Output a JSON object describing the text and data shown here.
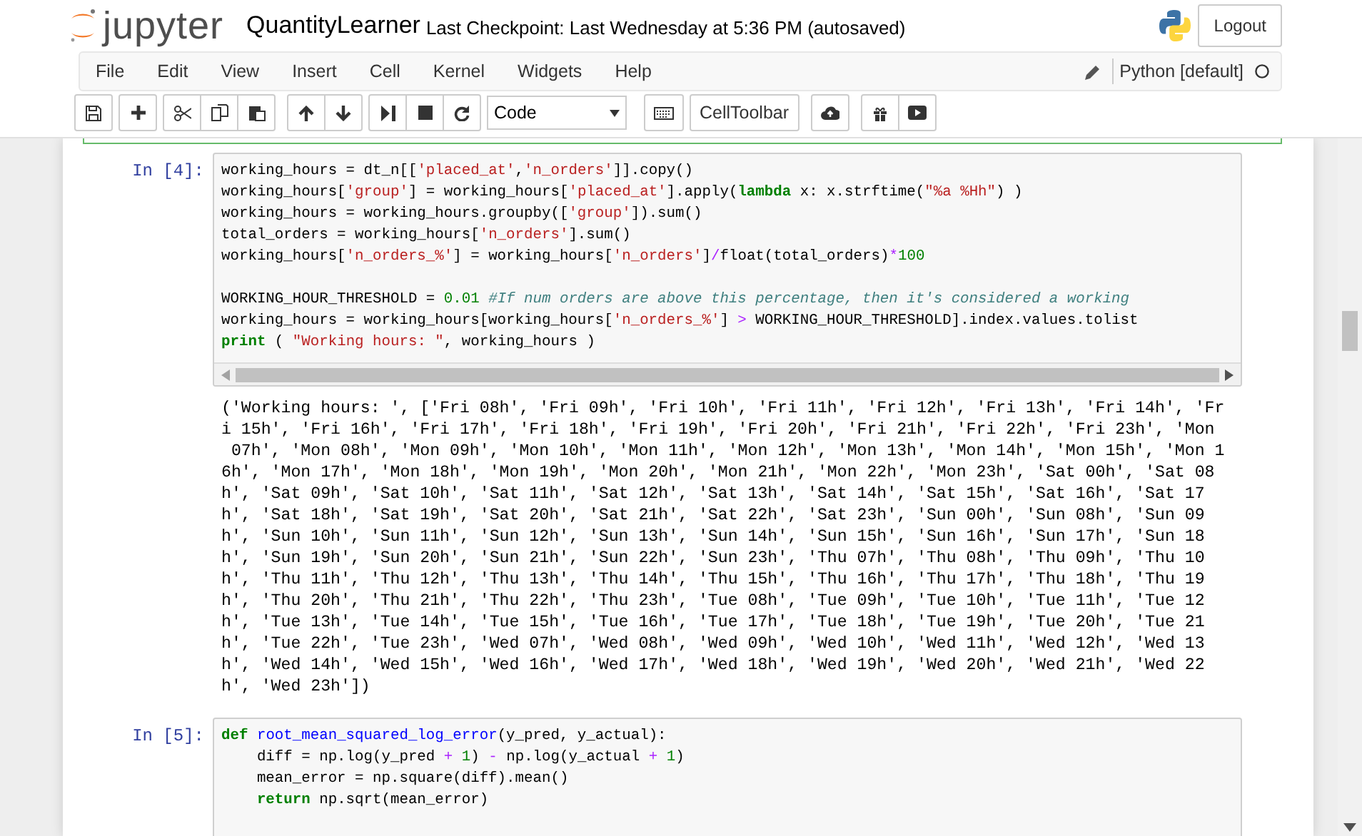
{
  "header": {
    "logo": "jupyter",
    "notebook_name": "QuantityLearner",
    "checkpoint": "Last Checkpoint: Last Wednesday at 5:36 PM (autosaved)",
    "logout": "Logout"
  },
  "menu": [
    "File",
    "Edit",
    "View",
    "Insert",
    "Cell",
    "Kernel",
    "Widgets",
    "Help"
  ],
  "kernel": {
    "name": "Python [default]",
    "busy": false
  },
  "toolbar": {
    "cell_type": "Code",
    "cell_toolbar": "CellToolbar"
  },
  "cells": [
    {
      "prompt": "In [4]:",
      "horizontal_scroll": true,
      "code": [
        {
          "tokens": [
            {
              "kind": "plain",
              "text": "working_hours = dt_n[["
            },
            {
              "kind": "str",
              "text": "'placed_at'"
            },
            {
              "kind": "plain",
              "text": ","
            },
            {
              "kind": "str",
              "text": "'n_orders'"
            },
            {
              "kind": "plain",
              "text": "]].copy()"
            }
          ]
        },
        {
          "tokens": [
            {
              "kind": "plain",
              "text": "working_hours["
            },
            {
              "kind": "str",
              "text": "'group'"
            },
            {
              "kind": "plain",
              "text": "] = working_hours["
            },
            {
              "kind": "str",
              "text": "'placed_at'"
            },
            {
              "kind": "plain",
              "text": "].apply("
            },
            {
              "kind": "kw",
              "text": "lambda"
            },
            {
              "kind": "plain",
              "text": " x: x.strftime("
            },
            {
              "kind": "str",
              "text": "\"%a %Hh\""
            },
            {
              "kind": "plain",
              "text": ") )"
            }
          ]
        },
        {
          "tokens": [
            {
              "kind": "plain",
              "text": "working_hours = working_hours.groupby(["
            },
            {
              "kind": "str",
              "text": "'group'"
            },
            {
              "kind": "plain",
              "text": "]).sum()"
            }
          ]
        },
        {
          "tokens": [
            {
              "kind": "plain",
              "text": "total_orders = working_hours["
            },
            {
              "kind": "str",
              "text": "'n_orders'"
            },
            {
              "kind": "plain",
              "text": "].sum()"
            }
          ]
        },
        {
          "tokens": [
            {
              "kind": "plain",
              "text": "working_hours["
            },
            {
              "kind": "str",
              "text": "'n_orders_%'"
            },
            {
              "kind": "plain",
              "text": "] = working_hours["
            },
            {
              "kind": "str",
              "text": "'n_orders'"
            },
            {
              "kind": "plain",
              "text": "]"
            },
            {
              "kind": "op",
              "text": "/"
            },
            {
              "kind": "plain",
              "text": "float(total_orders)"
            },
            {
              "kind": "op",
              "text": "*"
            },
            {
              "kind": "num",
              "text": "100"
            }
          ]
        },
        {
          "gap_before": true,
          "tokens": [
            {
              "kind": "plain",
              "text": "WORKING_HOUR_THRESHOLD = "
            },
            {
              "kind": "num",
              "text": "0.01"
            },
            {
              "kind": "comment",
              "text": " #If num orders are above this percentage, then it's considered a working"
            }
          ]
        },
        {
          "tokens": [
            {
              "kind": "plain",
              "text": "working_hours = working_hours[working_hours["
            },
            {
              "kind": "str",
              "text": "'n_orders_%'"
            },
            {
              "kind": "plain",
              "text": "] "
            },
            {
              "kind": "op",
              "text": ">"
            },
            {
              "kind": "plain",
              "text": " WORKING_HOUR_THRESHOLD].index.values.tolist"
            }
          ]
        },
        {
          "tokens": [
            {
              "kind": "kw",
              "text": "print"
            },
            {
              "kind": "plain",
              "text": " ( "
            },
            {
              "kind": "str",
              "text": "\"Working hours: \""
            },
            {
              "kind": "plain",
              "text": ", working_hours )"
            }
          ]
        }
      ],
      "output": [
        "('Working hours: ', ['Fri 08h', 'Fri 09h', 'Fri 10h', 'Fri 11h', 'Fri 12h', 'Fri 13h', 'Fri 14h', 'Fr",
        "i 15h', 'Fri 16h', 'Fri 17h', 'Fri 18h', 'Fri 19h', 'Fri 20h', 'Fri 21h', 'Fri 22h', 'Fri 23h', 'Mon",
        " 07h', 'Mon 08h', 'Mon 09h', 'Mon 10h', 'Mon 11h', 'Mon 12h', 'Mon 13h', 'Mon 14h', 'Mon 15h', 'Mon 1",
        "6h', 'Mon 17h', 'Mon 18h', 'Mon 19h', 'Mon 20h', 'Mon 21h', 'Mon 22h', 'Mon 23h', 'Sat 00h', 'Sat 08",
        "h', 'Sat 09h', 'Sat 10h', 'Sat 11h', 'Sat 12h', 'Sat 13h', 'Sat 14h', 'Sat 15h', 'Sat 16h', 'Sat 17",
        "h', 'Sat 18h', 'Sat 19h', 'Sat 20h', 'Sat 21h', 'Sat 22h', 'Sat 23h', 'Sun 00h', 'Sun 08h', 'Sun 09",
        "h', 'Sun 10h', 'Sun 11h', 'Sun 12h', 'Sun 13h', 'Sun 14h', 'Sun 15h', 'Sun 16h', 'Sun 17h', 'Sun 18",
        "h', 'Sun 19h', 'Sun 20h', 'Sun 21h', 'Sun 22h', 'Sun 23h', 'Thu 07h', 'Thu 08h', 'Thu 09h', 'Thu 10",
        "h', 'Thu 11h', 'Thu 12h', 'Thu 13h', 'Thu 14h', 'Thu 15h', 'Thu 16h', 'Thu 17h', 'Thu 18h', 'Thu 19",
        "h', 'Thu 20h', 'Thu 21h', 'Thu 22h', 'Thu 23h', 'Tue 08h', 'Tue 09h', 'Tue 10h', 'Tue 11h', 'Tue 12",
        "h', 'Tue 13h', 'Tue 14h', 'Tue 15h', 'Tue 16h', 'Tue 17h', 'Tue 18h', 'Tue 19h', 'Tue 20h', 'Tue 21",
        "h', 'Tue 22h', 'Tue 23h', 'Wed 07h', 'Wed 08h', 'Wed 09h', 'Wed 10h', 'Wed 11h', 'Wed 12h', 'Wed 13",
        "h', 'Wed 14h', 'Wed 15h', 'Wed 16h', 'Wed 17h', 'Wed 18h', 'Wed 19h', 'Wed 20h', 'Wed 21h', 'Wed 22",
        "h', 'Wed 23h'])"
      ]
    },
    {
      "prompt": "In [5]:",
      "horizontal_scroll": false,
      "code": [
        {
          "tokens": [
            {
              "kind": "kw",
              "text": "def "
            },
            {
              "kind": "fn",
              "text": "root_mean_squared_log_error"
            },
            {
              "kind": "plain",
              "text": "(y_pred, y_actual):"
            }
          ]
        },
        {
          "tokens": [
            {
              "kind": "plain",
              "text": "    diff = np.log(y_pred "
            },
            {
              "kind": "op",
              "text": "+ "
            },
            {
              "kind": "num",
              "text": "1"
            },
            {
              "kind": "plain",
              "text": ") "
            },
            {
              "kind": "op",
              "text": "-"
            },
            {
              "kind": "plain",
              "text": " np.log(y_actual "
            },
            {
              "kind": "op",
              "text": "+ "
            },
            {
              "kind": "num",
              "text": "1"
            },
            {
              "kind": "plain",
              "text": ")"
            }
          ]
        },
        {
          "tokens": [
            {
              "kind": "plain",
              "text": "    mean_error = np.square(diff).mean()"
            }
          ]
        },
        {
          "tokens": [
            {
              "kind": "kw",
              "text": "    return"
            },
            {
              "kind": "plain",
              "text": " np.sqrt(mean_error)"
            }
          ]
        }
      ]
    }
  ]
}
